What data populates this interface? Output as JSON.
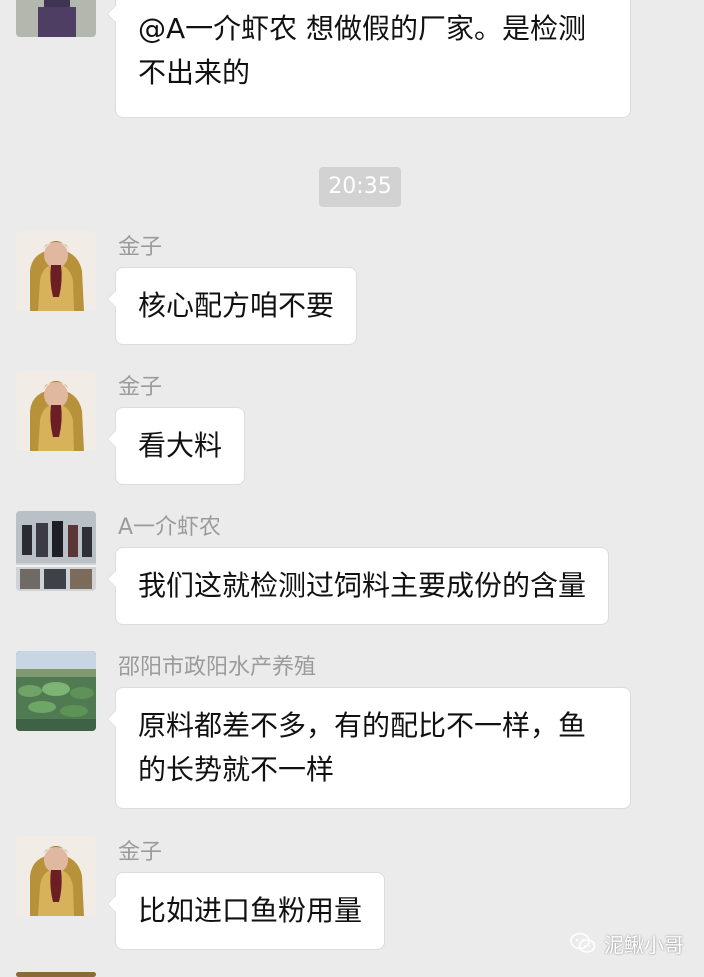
{
  "chat": {
    "timestamp": "20:35",
    "messages": [
      {
        "sender": "",
        "avatar": "young-man-photo",
        "text": "@A一介虾农 想做假的厂家。是检测不出来的"
      },
      {
        "sender": "金子",
        "avatar": "woman-gold-jacket-photo",
        "text": "核心配方咱不要"
      },
      {
        "sender": "金子",
        "avatar": "woman-gold-jacket-photo",
        "text": "看大料"
      },
      {
        "sender": "A一介虾农",
        "avatar": "group-collage-photo",
        "text": "我们这就检测过饲料主要成份的含量"
      },
      {
        "sender": "邵阳市政阳水产养殖",
        "avatar": "pond-landscape-photo",
        "text": "原料都差不多，有的配比不一样，鱼的长势就不一样"
      },
      {
        "sender": "金子",
        "avatar": "woman-gold-jacket-photo",
        "text": "比如进口鱼粉用量"
      }
    ]
  },
  "watermark": {
    "text": "泥鳅小哥",
    "icon": "wechat-icon"
  }
}
